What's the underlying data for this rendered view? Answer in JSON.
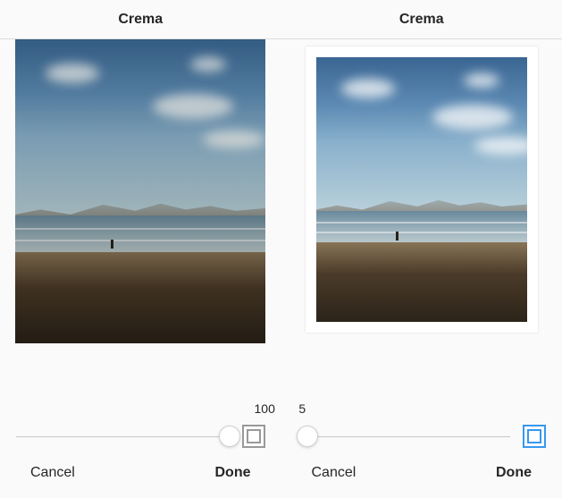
{
  "panels": [
    {
      "filter_name": "Crema",
      "slider_value": "100",
      "slider_percent": 100,
      "frame_active": false,
      "cancel_label": "Cancel",
      "done_label": "Done"
    },
    {
      "filter_name": "Crema",
      "slider_value": "5",
      "slider_percent": 5,
      "frame_active": true,
      "cancel_label": "Cancel",
      "done_label": "Done"
    }
  ]
}
